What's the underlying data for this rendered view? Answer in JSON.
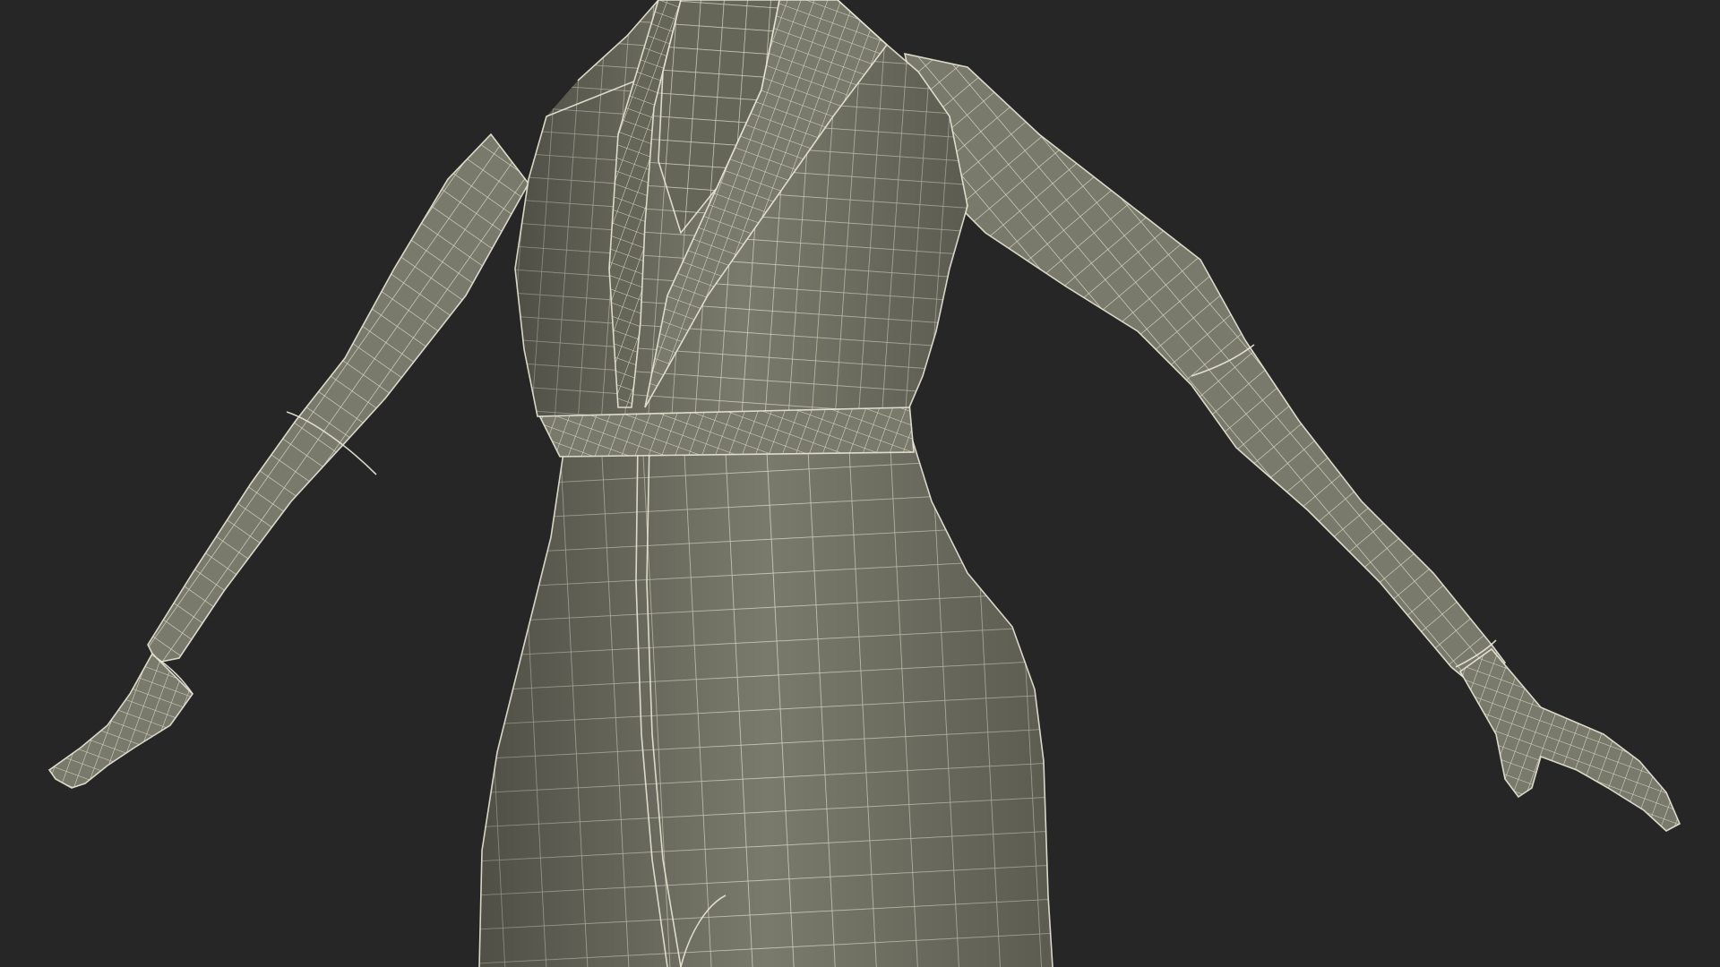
{
  "scene": {
    "background_color": "#262626",
    "mesh_fill_color": "#7a7a6c",
    "mesh_shade_color": "#656558",
    "wire_color": "#e9e8d6",
    "subject": "wireframe-female-jumpsuit-model"
  }
}
